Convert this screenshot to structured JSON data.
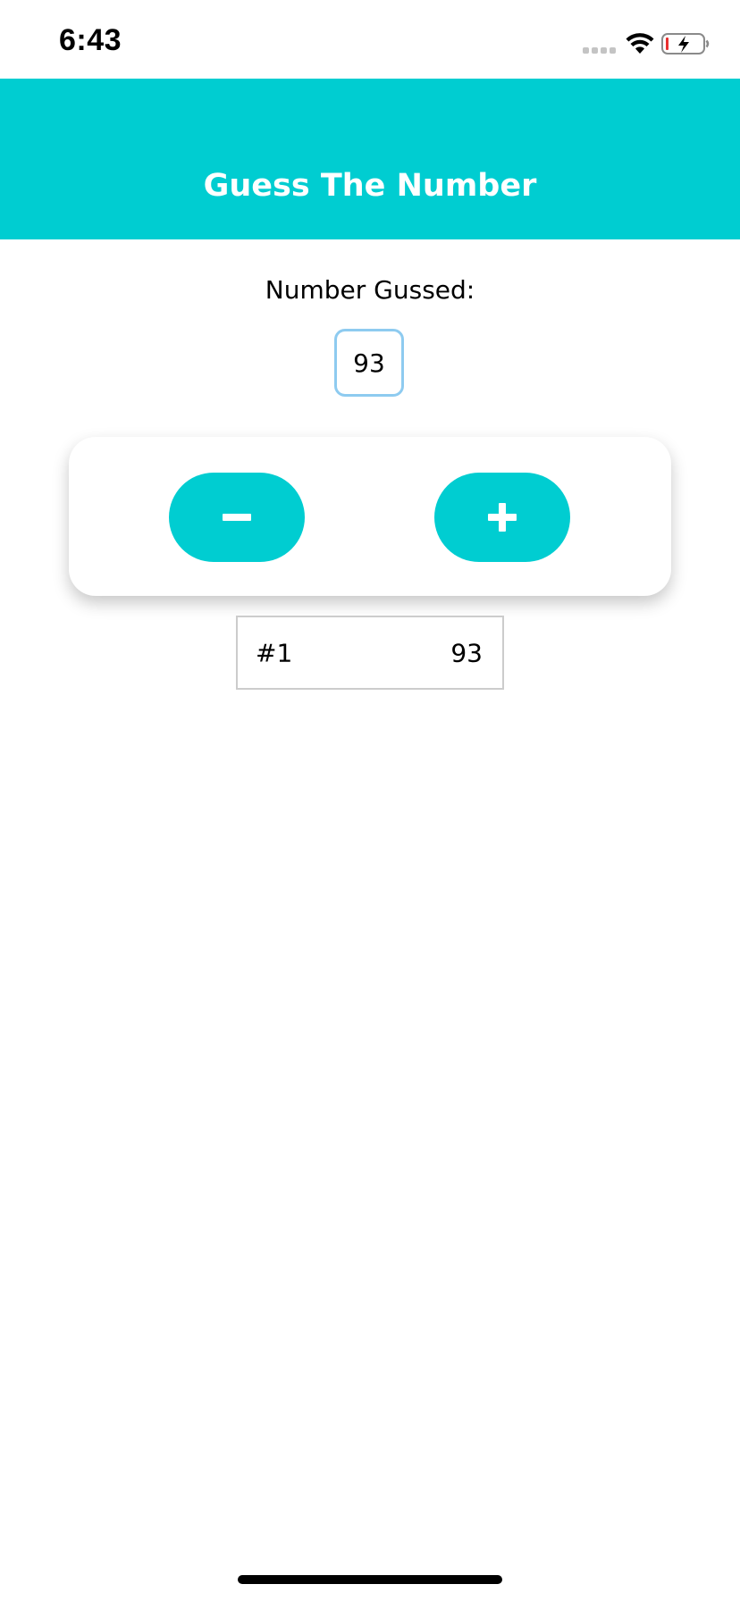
{
  "status_bar": {
    "time": "6:43",
    "signal_icon": "cellular-signal-icon",
    "wifi_icon": "wifi-icon",
    "battery_icon": "battery-charging-icon",
    "battery_color": "#e8302f"
  },
  "header": {
    "title": "Guess The Number",
    "background_color": "#00cdd1"
  },
  "main": {
    "label": "Number Gussed:",
    "current_guess": "93"
  },
  "controls": {
    "decrement_icon": "minus-icon",
    "increment_icon": "plus-icon",
    "button_color": "#00cdd1"
  },
  "history": [
    {
      "index": "#1",
      "value": "93"
    }
  ]
}
